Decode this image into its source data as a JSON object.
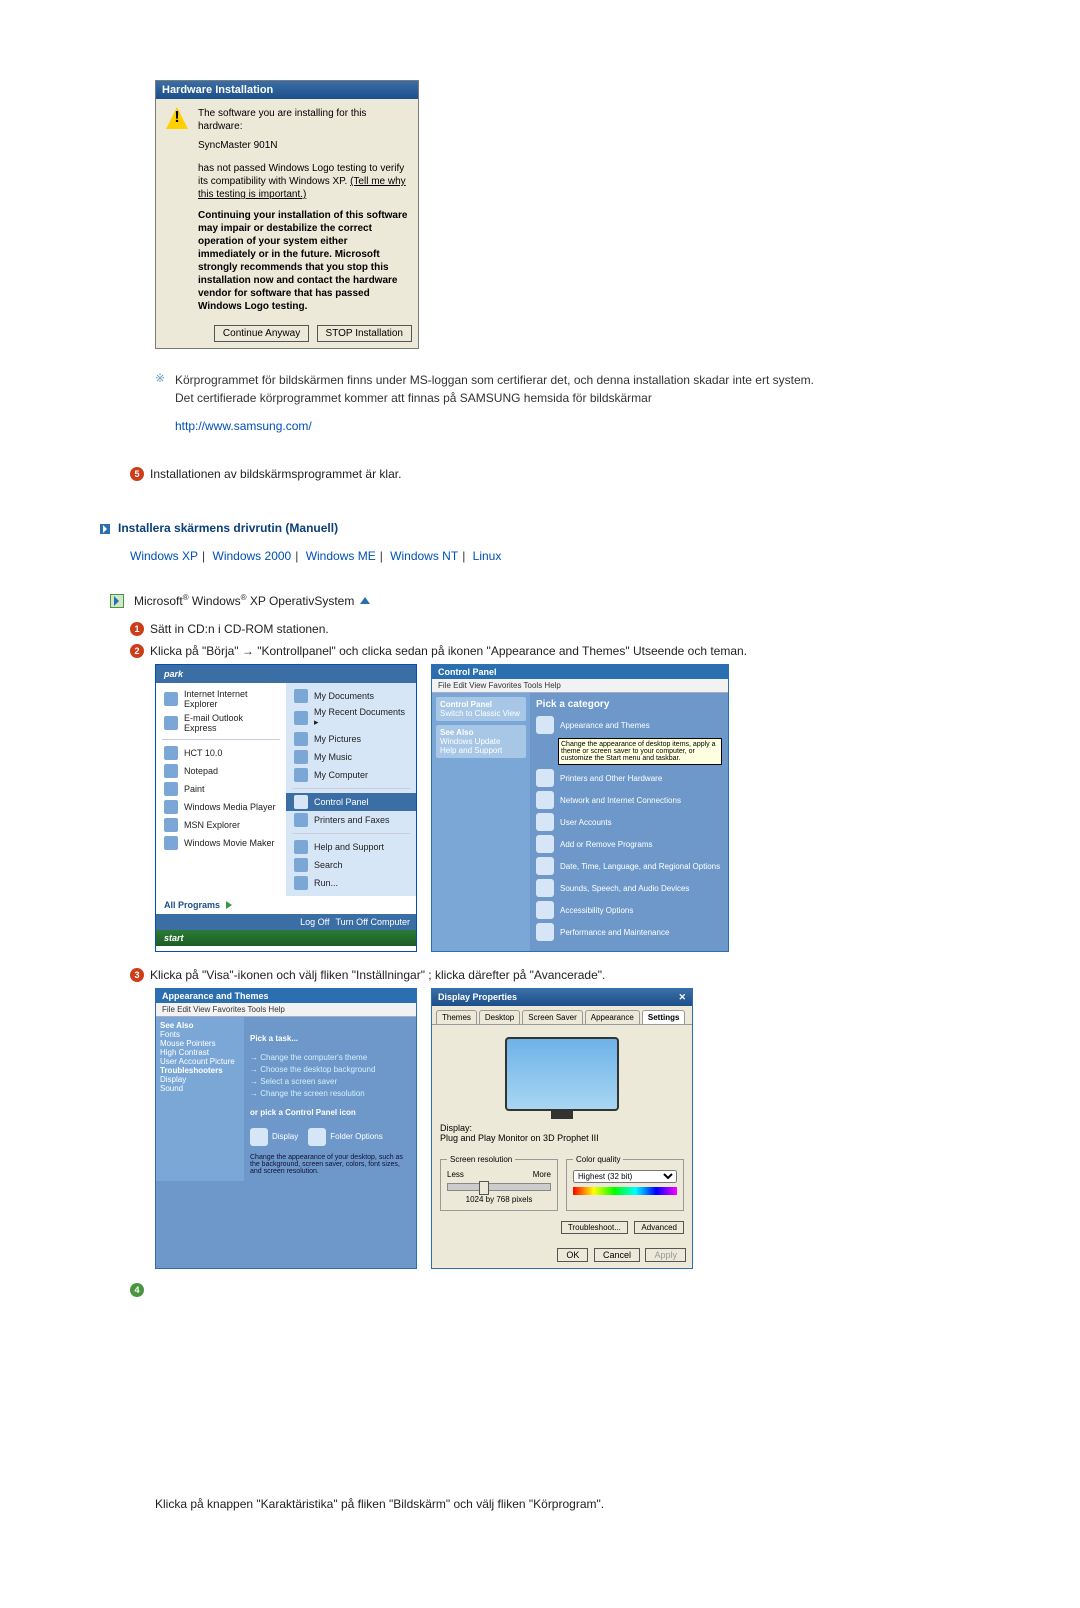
{
  "dialog": {
    "title": "Hardware Installation",
    "line1": "The software you are installing for this hardware:",
    "device": "SyncMaster 901N",
    "line2a": "has not passed Windows Logo testing to verify its compatibility with Windows XP.",
    "tell_link": "(Tell me why this testing is important.)",
    "bold": "Continuing your installation of this software may impair or destabilize the correct operation of your system either immediately or in the future. Microsoft strongly recommends that you stop this installation now and contact the hardware vendor for software that has passed Windows Logo testing.",
    "btn_continue": "Continue Anyway",
    "btn_stop": "STOP Installation"
  },
  "note": {
    "asterisk": "※",
    "text1": "Körprogrammet för bildskärmen finns under MS-loggan som certifierar det, och denna installation skadar inte ert system.",
    "text2": "Det certifierade körprogrammet kommer att finnas på SAMSUNG hemsida för bildskärmar",
    "url": "http://www.samsung.com/"
  },
  "step5": "Installationen av bildskärmsprogrammet är klar.",
  "section_title": "Installera skärmens drivrutin (Manuell)",
  "os": {
    "xp": "Windows XP",
    "2k": "Windows 2000",
    "me": "Windows ME",
    "nt": "Windows NT",
    "lx": "Linux"
  },
  "os_heading_pre": "Microsoft",
  "os_heading_mid": " Windows",
  "os_heading_post": " XP OperativSystem",
  "sup": "®",
  "step1": "Sätt in CD:n i CD-ROM stationen.",
  "step2": "Klicka på \"Börja\" → \"Kontrollpanel\" och clicka sedan på ikonen \"Appearance and Themes\" Utseende och teman.",
  "step3": "Klicka på \"Visa\"-ikonen och välj fliken \"Inställningar\" ; klicka därefter på \"Avancerade\".",
  "final_line": "Klicka på knappen \"Karaktäristika\" på fliken \"Bildskärm\" och välj fliken \"Körprogram\".",
  "startmenu": {
    "user": "park",
    "left": [
      "Internet  Internet Explorer",
      "E-mail  Outlook Express",
      "HCT 10.0",
      "Notepad",
      "Paint",
      "Windows Media Player",
      "MSN Explorer",
      "Windows Movie Maker"
    ],
    "all": "All Programs",
    "right": [
      "My Documents",
      "My Recent Documents  ▸",
      "My Pictures",
      "My Music",
      "My Computer",
      "Control Panel",
      "Printers and Faxes",
      "Help and Support",
      "Search",
      "Run..."
    ],
    "cp_idx": 5,
    "logoff": "Log Off",
    "turnoff": "Turn Off Computer",
    "startbtn": "start"
  },
  "cp": {
    "title": "Control Panel",
    "switch": "Switch to Classic View",
    "seealso": "See Also",
    "pick": "Pick a category",
    "cats": [
      "Appearance and Themes",
      "Printers and Other Hardware",
      "Network and Internet Connections",
      "User Accounts",
      "Add or Remove Programs",
      "Date, Time, Language, and Regional Options",
      "Sounds, Speech, and Audio Devices",
      "Accessibility Options",
      "Performance and Maintenance"
    ],
    "cat_tip": "Change the appearance of desktop items, apply a theme or screen saver to your computer, or customize the Start menu and taskbar."
  },
  "at": {
    "title": "Appearance and Themes",
    "pick_task": "Pick a task...",
    "tasks": [
      "Change the computer's theme",
      "Choose the desktop background",
      "Select a screen saver",
      "Change the screen resolution"
    ],
    "or_pick": "or pick a Control Panel icon",
    "icons": [
      "Display",
      "Folder Options"
    ],
    "tip": "Change the appearance of your desktop, such as the background, screen saver, colors, font sizes, and screen resolution."
  },
  "dp": {
    "title": "Display Properties",
    "tabs": [
      "Themes",
      "Desktop",
      "Screen Saver",
      "Appearance",
      "Settings"
    ],
    "active_tab": 4,
    "display_lbl": "Display:",
    "display_val": "Plug and Play Monitor on 3D Prophet III",
    "res_lbl": "Screen resolution",
    "less": "Less",
    "more": "More",
    "res_val": "1024 by 768 pixels",
    "color_lbl": "Color quality",
    "color_val": "Highest (32 bit)",
    "troubleshoot": "Troubleshoot...",
    "advanced": "Advanced",
    "ok": "OK",
    "cancel": "Cancel",
    "apply": "Apply"
  }
}
